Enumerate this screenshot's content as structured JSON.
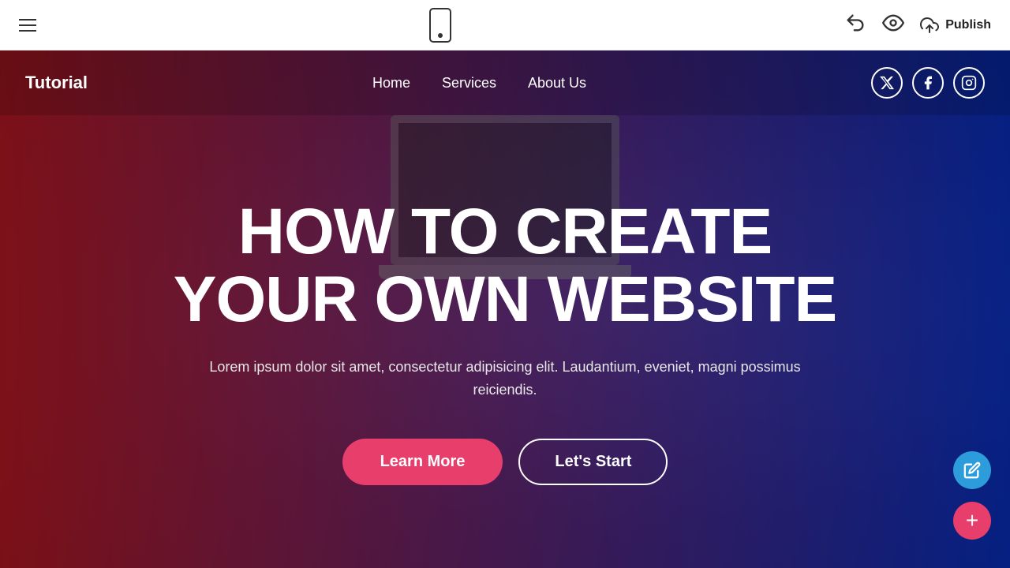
{
  "toolbar": {
    "hamburger_label": "menu",
    "undo_label": "undo",
    "eye_label": "preview",
    "publish_label": "Publish",
    "phone_icon_label": "mobile view"
  },
  "site_navbar": {
    "logo": "Tutorial",
    "nav_links": [
      {
        "id": "home",
        "label": "Home"
      },
      {
        "id": "services",
        "label": "Services"
      },
      {
        "id": "about",
        "label": "About Us"
      }
    ],
    "social_icons": [
      {
        "id": "twitter",
        "symbol": "𝕏"
      },
      {
        "id": "facebook",
        "symbol": "f"
      },
      {
        "id": "instagram",
        "symbol": "in"
      }
    ]
  },
  "hero": {
    "title_line1": "HOW TO CREATE",
    "title_line2": "YOUR OWN WEBSITE",
    "subtitle": "Lorem ipsum dolor sit amet, consectetur adipisicing elit. Laudantium, eveniet, magni possimus reiciendis.",
    "btn_learn_more": "Learn More",
    "btn_lets_start": "Let's Start"
  },
  "fab": {
    "edit_label": "✎",
    "add_label": "+"
  }
}
